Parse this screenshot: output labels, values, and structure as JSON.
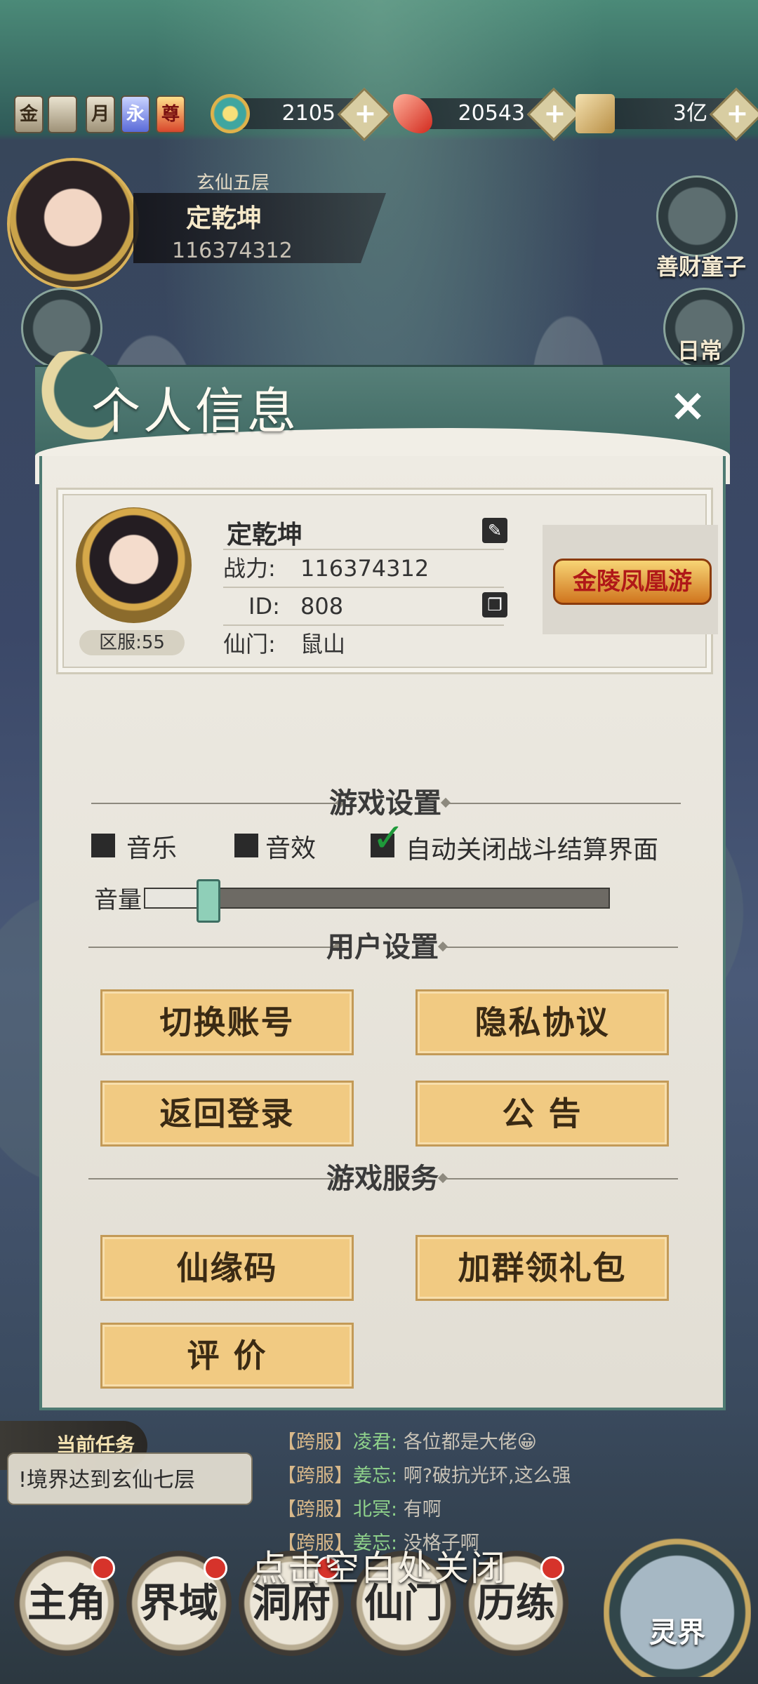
{
  "topbar": {
    "badges": [
      "金",
      "",
      "月",
      "永",
      "尊"
    ],
    "resources": [
      {
        "icon": "spirit-orb-icon",
        "value": "2105"
      },
      {
        "icon": "red-crystal-icon",
        "value": "20543"
      },
      {
        "icon": "scroll-coin-icon",
        "value": "3亿"
      }
    ],
    "plus": "+"
  },
  "hero": {
    "realm": "玄仙五层",
    "name": "定乾坤",
    "power": "116374312",
    "right_buttons": [
      "善财童子",
      "日常"
    ]
  },
  "dialog": {
    "title": "个人信息",
    "close": "×",
    "profile": {
      "name": "定乾坤",
      "power_label": "战力:",
      "power": "116374312",
      "id_label": "ID:",
      "id": "808",
      "sect_label": "仙门:",
      "sect": "鼠山",
      "server": "区服:55",
      "title_badge": "金陵凤凰游"
    },
    "game_settings": {
      "header": "游戏设置",
      "music": "音乐",
      "sfx": "音效",
      "auto_close": "自动关闭战斗结算界面",
      "volume_label": "音量",
      "volume": 0.11,
      "music_on": false,
      "sfx_on": false,
      "auto_close_on": true
    },
    "user_settings": {
      "header": "用户设置",
      "switch_account": "切换账号",
      "privacy": "隐私协议",
      "back_login": "返回登录",
      "notice": "公 告"
    },
    "game_service": {
      "header": "游戏服务",
      "fate_code": "仙缘码",
      "join_group": "加群领礼包",
      "rate": "评 价"
    }
  },
  "task": {
    "header": "当前任务",
    "text": "!境界达到玄仙七层"
  },
  "chat": [
    {
      "tag": "【跨服】",
      "who": "凌君:",
      "msg": "各位都是大佬😀"
    },
    {
      "tag": "【跨服】",
      "who": "姜忘:",
      "msg": "啊?破抗光环,这么强"
    },
    {
      "tag": "【跨服】",
      "who": "北冥:",
      "msg": "有啊"
    },
    {
      "tag": "【跨服】",
      "who": "姜忘:",
      "msg": "没格子啊"
    }
  ],
  "close_hint": "点击空白处关闭",
  "nav": [
    "主角",
    "界域",
    "洞府",
    "仙门",
    "历练"
  ],
  "lingjie": "灵界",
  "colors": {
    "accent": "#4e7a72",
    "button": "#f1ca82"
  }
}
